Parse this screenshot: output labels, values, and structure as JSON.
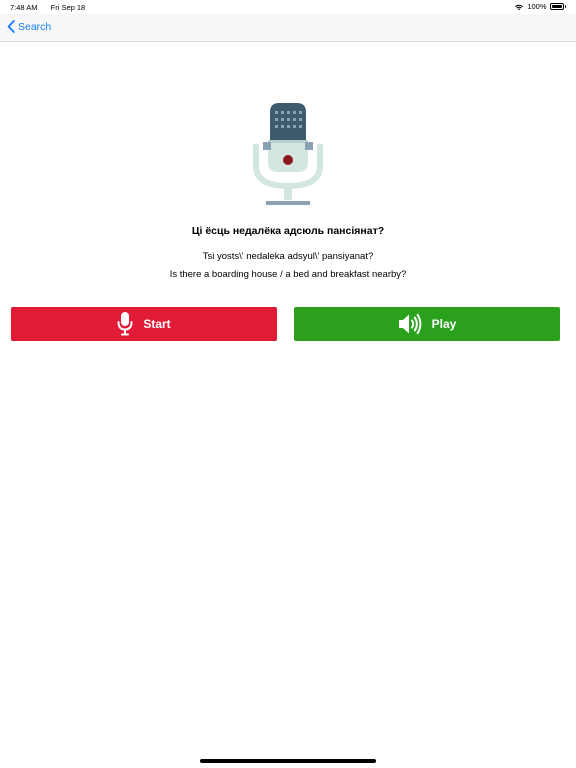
{
  "status_bar": {
    "time": "7:48 AM",
    "date": "Fri Sep 18",
    "battery": "100%"
  },
  "nav": {
    "back_label": "Search"
  },
  "phrase": {
    "native": "Ці ёсць недалёка адсюль пансіянат?",
    "transliteration": "Tsi yosts\\' nedaleka adsyul\\' pansiyanat?",
    "english": "Is there a boarding house / a bed and breakfast nearby?"
  },
  "buttons": {
    "start_label": "Start",
    "play_label": "Play"
  },
  "icons": {
    "back": "chevron-left-icon",
    "record": "microphone-icon",
    "play": "speaker-icon",
    "illustration": "microphone-illustration"
  },
  "colors": {
    "accent": "#147efb",
    "start": "#e21b36",
    "play": "#2aa01d",
    "mic_head": "#3e5b6e",
    "mic_body": "#d3e6e2",
    "record_dot": "#8b1a1a"
  }
}
